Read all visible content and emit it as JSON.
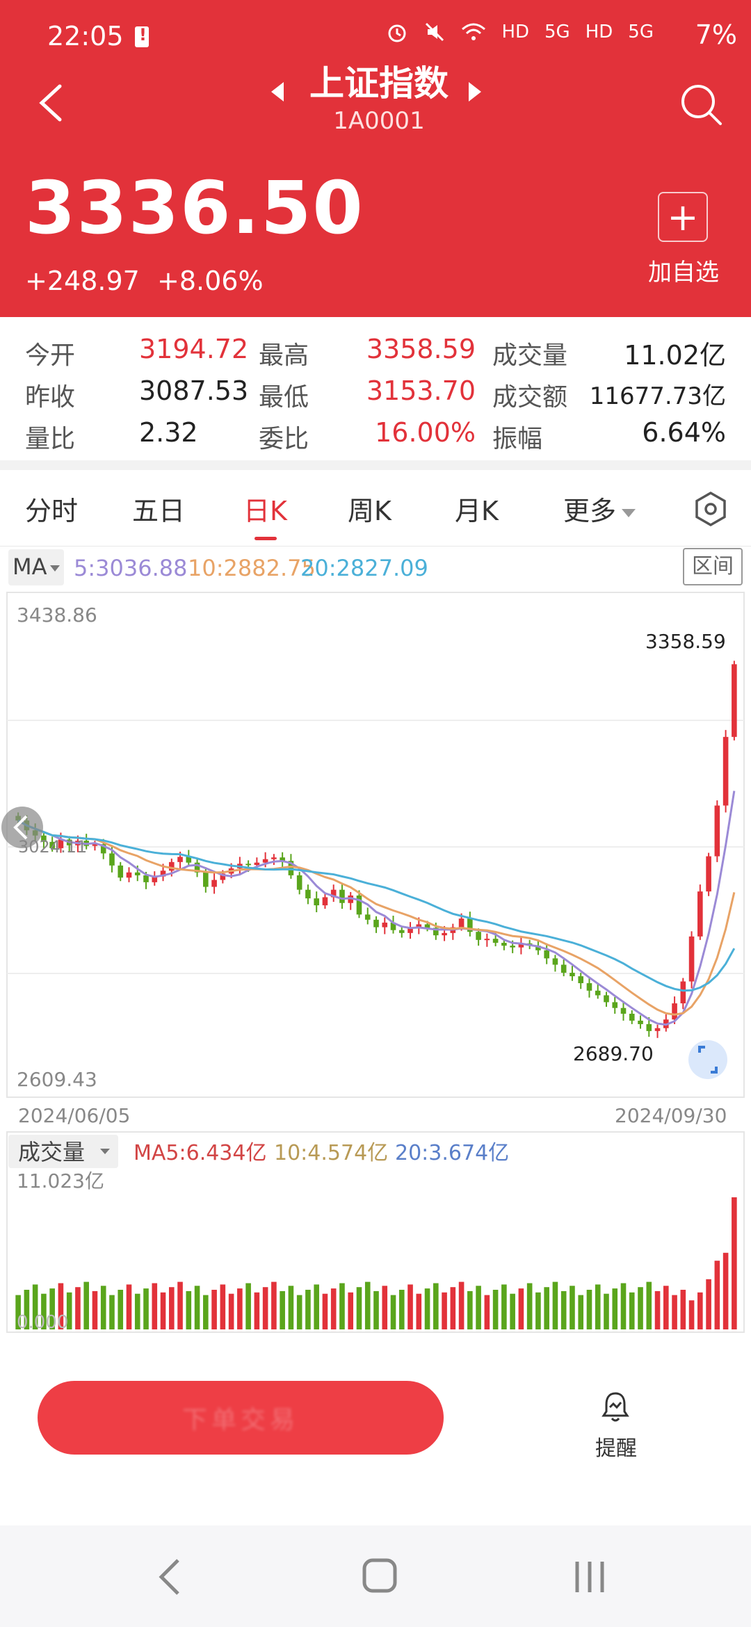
{
  "status_bar": {
    "time": "22:05",
    "network": "HD",
    "network2": "5G",
    "network3": "HD",
    "network4": "5G",
    "battery": "7%"
  },
  "header": {
    "title": "上证指数",
    "code": "1A0001",
    "price": "3336.50",
    "change": "+248.97",
    "change_pct": "+8.06%",
    "add_label": "加自选"
  },
  "stats": {
    "open_label": "今开",
    "open": "3194.72",
    "high_label": "最高",
    "high": "3358.59",
    "vol_label": "成交量",
    "vol": "11.02亿",
    "prev_label": "昨收",
    "prev": "3087.53",
    "low_label": "最低",
    "low": "3153.70",
    "amount_label": "成交额",
    "amount": "11677.73亿",
    "ratio_label": "量比",
    "ratio": "2.32",
    "bid_label": "委比",
    "bid": "16.00%",
    "amp_label": "振幅",
    "amp": "6.64%"
  },
  "tabs": {
    "items": [
      "分时",
      "五日",
      "日K",
      "周K",
      "月K"
    ],
    "more": "更多",
    "active_index": 2
  },
  "ma_row": {
    "selector": "MA",
    "ma5": "5:3036.88",
    "ma10": "10:2882.75",
    "ma20": "20:2827.09",
    "range": "区间"
  },
  "chart_data": {
    "type": "candlestick",
    "y_max_label": "3438.86",
    "y_min_label": "2609.43",
    "ylim": [
      2609.43,
      3438.86
    ],
    "date_start": "2024/06/05",
    "date_end": "2024/09/30",
    "high_marker": "3358.59",
    "low_marker": "2689.70",
    "left_marker": "3024.11",
    "closes": [
      3065,
      3048,
      3039,
      3028,
      3017,
      3032,
      3022,
      3030,
      3021,
      3024,
      3008,
      2987,
      2966,
      2975,
      2970,
      2958,
      2968,
      2978,
      2993,
      3002,
      2992,
      2975,
      2950,
      2962,
      2973,
      2982,
      2990,
      2988,
      2992,
      2998,
      3001,
      2995,
      2970,
      2945,
      2930,
      2918,
      2932,
      2945,
      2922,
      2935,
      2902,
      2893,
      2880,
      2888,
      2875,
      2870,
      2880,
      2885,
      2879,
      2866,
      2870,
      2880,
      2895,
      2872,
      2858,
      2860,
      2853,
      2848,
      2845,
      2852,
      2848,
      2840,
      2826,
      2815,
      2801,
      2795,
      2783,
      2770,
      2762,
      2750,
      2740,
      2730,
      2718,
      2712,
      2700,
      2705,
      2720,
      2748,
      2786,
      2864,
      2942,
      3003,
      3091,
      3210,
      3336
    ],
    "ma5_color": "#9b8ad6",
    "ma10_color": "#e8a366",
    "ma20_color": "#4bb0d8",
    "up_color": "#e2323a",
    "down_color": "#5aa51c"
  },
  "volume": {
    "label": "成交量",
    "ma5": "MA5:6.434亿",
    "ma10": "10:4.574亿",
    "ma20": "20:3.674亿",
    "max_label": "11.023亿",
    "min_label": "0.000"
  },
  "bottom": {
    "trade_label": "下单交易",
    "remind_label": "提醒"
  }
}
